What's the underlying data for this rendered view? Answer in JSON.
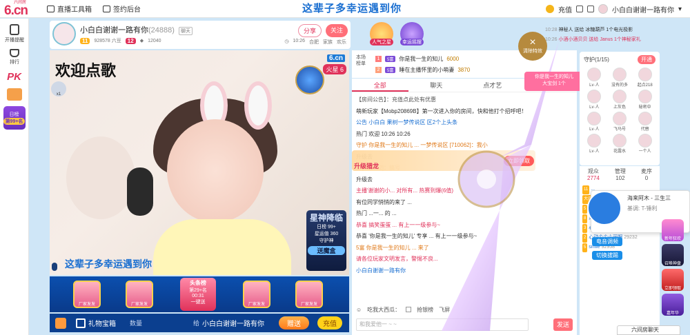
{
  "topbar": {
    "logo_small": "六间房",
    "logo_big": "6.cn",
    "links": [
      {
        "label": "直播工具箱"
      },
      {
        "label": "签约后台"
      }
    ],
    "marquee": "这辈子多幸运遇到你",
    "recharge": "充值",
    "user": "小白白谢谢一路有你"
  },
  "sidebar": {
    "items": [
      {
        "label": "开播提醒"
      },
      {
        "label": "排行"
      }
    ],
    "pk": "PK",
    "rank_title": "日榜",
    "rank_value": "第99+名"
  },
  "host": {
    "name": "小白白谢谢一路有你",
    "room_id": "(24888)",
    "tag": "聊天",
    "level": "11",
    "fans": "928578 六豆",
    "level2": "12",
    "coins": "12040",
    "share": "分享",
    "follow": "关注",
    "time": "10:26",
    "city": "合肥",
    "family": "家族",
    "family_tag": "欢乐"
  },
  "badges": {
    "b1": "人气之星",
    "b2": "幸运摇摆"
  },
  "notices": [
    {
      "time": "10:28",
      "text": "神秘人 送给 冰糖葫芦 1个电光极影"
    },
    {
      "time": "10:26",
      "text": "小酒小酒贝贝 送给 Janus 1个神秘家礼"
    }
  ],
  "clear_fx": "清除特效",
  "video": {
    "title": "欢迎点歌",
    "room": "6.cn",
    "hot": "火星 6",
    "fans_count": "x1",
    "star_title": "星神降临",
    "star_line1": "日榜 99+",
    "star_line2": "星运值 360",
    "star_tag": "守护神",
    "star_btn": "送魔盒",
    "marquee": "这辈子多幸运遇到你"
  },
  "gifts": {
    "item_label": "厂家发发",
    "center_title": "头条榜",
    "center_rank": "第29+名",
    "center_time": "00:31",
    "center_btn": "一键送"
  },
  "ctrlbar": {
    "chest": "礼物宝箱",
    "qty_placeholder": "数量",
    "to": "给",
    "target": "小白白谢谢一路有你",
    "give": "赠送",
    "recharge": "充值"
  },
  "rank": {
    "label1": "本场",
    "label2": "榜单",
    "rows": [
      {
        "num": "1",
        "vip": "5富",
        "name": "你是我一生的知儿",
        "value": "6000"
      },
      {
        "num": "2",
        "vip": "5富",
        "name": "睡在主播怀里的小萌妻",
        "value": "3870"
      }
    ]
  },
  "fan_rank": {
    "line1": "你是我一生的知儿",
    "line2": "大宝剑 1个"
  },
  "chat": {
    "tabs": [
      "全部",
      "聊天",
      "点才艺",
      "礼单"
    ],
    "lines": [
      {
        "cls": "ann",
        "text": "【房间公告】：充值点此处有优惠"
      },
      {
        "cls": "",
        "text": "萌新玩家【Mobp20869B】第一次进入你的房间，快和他打个招呼吧！"
      },
      {
        "cls": "blue",
        "text": "公告 小白白 果树一梦传说区 区2个上头条"
      },
      {
        "cls": "",
        "text": "热门 欢迎 10:26 10:26"
      },
      {
        "cls": "orange",
        "text": "守护 你是我一生的知儿 ... 一梦传说区 [710062]：我小"
      },
      {
        "cls": "",
        "text": "升级去"
      },
      {
        "cls": "orange",
        "text": "... [710062]：搞号"
      },
      {
        "cls": "",
        "text": "升级去"
      },
      {
        "cls": "warn",
        "text": "主播'谢谢的小... 对所有... 热赛到爆(6值)"
      },
      {
        "cls": "",
        "text": "有位同学悄悄的来了 ..."
      },
      {
        "cls": "",
        "text": "热门 ...一... 的 ..."
      },
      {
        "cls": "warn",
        "text": "恭喜 搞笑蛋蛋 ... 有上一一级参与~"
      },
      {
        "cls": "",
        "text": "恭喜 '你是我一生的知儿' 专享 ... 有上一一级参与~"
      },
      {
        "cls": "orange",
        "text": "5富 你是我一生的知儿 ... 来了"
      },
      {
        "cls": "warn",
        "text": "请各位玩家文明发言，警惕不良..."
      },
      {
        "cls": "blue",
        "text": "小白白谢谢一路有你"
      }
    ],
    "tool_emoji": "吃我大西瓜：",
    "tool_gift": "抢银榜",
    "tool_flash": "飞屏",
    "input_placeholder": "和我爱他一 ~ ~",
    "send": "发送",
    "upgrade_tag": "升级猎龙",
    "upgrade_btn": "立即领取"
  },
  "guardian": {
    "title": "守护",
    "count": "(1/15)",
    "open": "开通",
    "members": [
      {
        "name": "Lv·人"
      },
      {
        "name": "没有的多"
      },
      {
        "name": "起点218"
      },
      {
        "name": "Lv·人"
      },
      {
        "name": "上灰色"
      },
      {
        "name": "秘密中"
      },
      {
        "name": "Lv·人"
      },
      {
        "name": "飞马号"
      },
      {
        "name": "代替"
      },
      {
        "name": "Lv·人"
      },
      {
        "name": "花露水"
      },
      {
        "name": "一个人"
      }
    ]
  },
  "audience": {
    "headers": [
      {
        "label": "观众",
        "value": "2774"
      },
      {
        "label": "管理",
        "value": "102"
      },
      {
        "label": "麦序",
        "value": "0"
      }
    ],
    "list": [
      {
        "lv": "11",
        "name": "...",
        "num": ""
      },
      {
        "lv": "大肉",
        "name": "...",
        "num": "13514"
      },
      {
        "lv": "5",
        "name": "你是我一生的知儿",
        "num": "5000005"
      },
      {
        "lv": "8",
        "name": "果树一梦传说区",
        "num": "710062"
      },
      {
        "lv": "3",
        "name": "心动个个比阳太阳",
        "num": "(才"
      },
      {
        "lv": "2",
        "name": "心动个个小丽啊",
        "num": "29232"
      },
      {
        "lv": "5",
        "name": "smile",
        "num": "92958"
      }
    ]
  },
  "popcard": {
    "name": "海来阿木 - 三生三",
    "sub": "基调: T-锤利",
    "sound": "电音调频",
    "switch": "切换拔踢"
  },
  "events": [
    {
      "label": "新年狂欢"
    },
    {
      "label": "召唤神盘"
    },
    {
      "label": "立即领取"
    },
    {
      "label": "嘉年华"
    }
  ],
  "sixroom_chat": "六间房聊天"
}
